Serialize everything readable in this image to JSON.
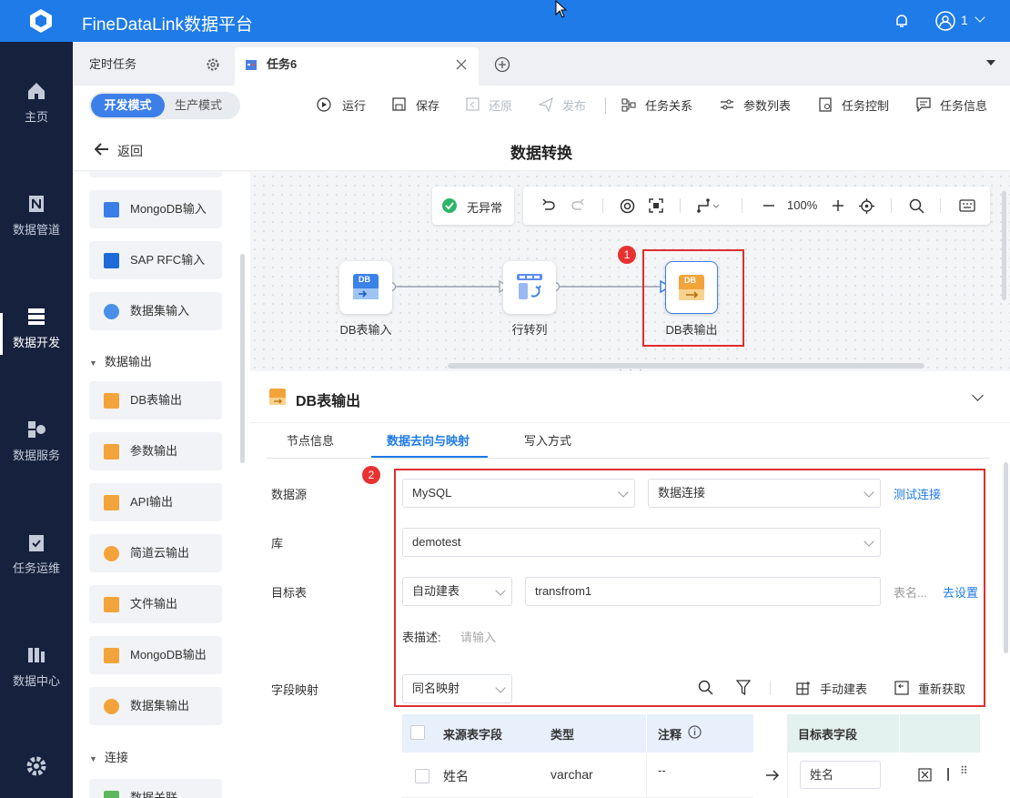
{
  "app": {
    "title": "FineDataLink数据平台",
    "user": "1"
  },
  "nav": {
    "items": [
      {
        "label": "主页"
      },
      {
        "label": "数据管道"
      },
      {
        "label": "数据开发"
      },
      {
        "label": "数据服务"
      },
      {
        "label": "任务运维"
      },
      {
        "label": "数据中心"
      }
    ]
  },
  "tabs": {
    "scheduled": "定时任务",
    "active": "任务6"
  },
  "mode": {
    "dev": "开发模式",
    "prod": "生产模式"
  },
  "toolbar": {
    "run": "运行",
    "save": "保存",
    "restore": "还原",
    "publish": "发布",
    "relation": "任务关系",
    "params": "参数列表",
    "control": "任务控制",
    "info": "任务信息"
  },
  "header": {
    "back": "返回",
    "title": "数据转换"
  },
  "leftpanel": {
    "top_items": [
      "MongoDB输入",
      "SAP RFC输入",
      "数据集输入"
    ],
    "section_output": "数据输出",
    "output_items": [
      "DB表输出",
      "参数输出",
      "API输出",
      "简道云输出",
      "文件输出",
      "MongoDB输出",
      "数据集输出"
    ],
    "section_connect": "连接",
    "connect_items": [
      "数据关联"
    ]
  },
  "canvas": {
    "status": "无异常",
    "zoom": "100%",
    "nodes": [
      "DB表输入",
      "行转列",
      "DB表输出"
    ],
    "node_icon_text": "DB"
  },
  "detail": {
    "title": "DB表输出",
    "tabs": [
      "节点信息",
      "数据去向与映射",
      "写入方式"
    ],
    "labels": {
      "datasource": "数据源",
      "db": "库",
      "target": "目标表",
      "mapping": "字段映射",
      "desc": "表描述:"
    },
    "datasource": "MySQL",
    "connection": "数据连接",
    "test": "测试连接",
    "db": "demotest",
    "create": "自动建表",
    "table": "transfrom1",
    "tablename_hint": "表名...",
    "setup": "去设置",
    "desc_placeholder": "请输入",
    "mapping_mode": "同名映射",
    "manual": "手动建表",
    "refresh": "重新获取",
    "cols": {
      "src": "来源表字段",
      "type": "类型",
      "note": "注释",
      "target": "目标表字段"
    },
    "row": {
      "src": "姓名",
      "type": "varchar",
      "note": "--",
      "target": "姓名"
    }
  },
  "badges": [
    "1",
    "2"
  ]
}
